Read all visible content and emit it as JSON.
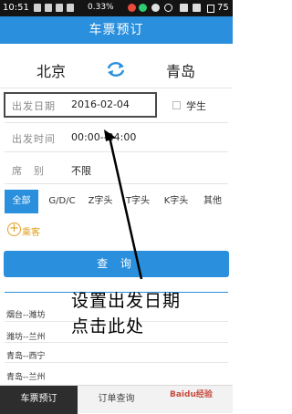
{
  "statusbar": {
    "time": "10:51",
    "percent": "0.33%",
    "battery": "75"
  },
  "header": {
    "title": "车票预订"
  },
  "route": {
    "from": "北京",
    "to": "青岛"
  },
  "form": {
    "date_label": "出发日期",
    "date_value": "2016-02-04",
    "student_label": "学生",
    "time_label": "出发时间",
    "time_value": "00:00--24:00",
    "seat_label": "席　别",
    "seat_value": "不限"
  },
  "tabs": [
    "全部",
    "G/D/C",
    "Z字头",
    "T字头",
    "K字头",
    "其他"
  ],
  "add_passenger": "乘客",
  "query_button": "查 询",
  "history": [
    "烟台--潍坊",
    "潍坊--兰州",
    "青岛--西宁",
    "青岛--兰州"
  ],
  "bottom_nav": [
    "车票预订",
    "订单查询",
    "Baidu经验"
  ],
  "annotation": {
    "line1": "设置出发日期",
    "line2": "点击此处"
  }
}
